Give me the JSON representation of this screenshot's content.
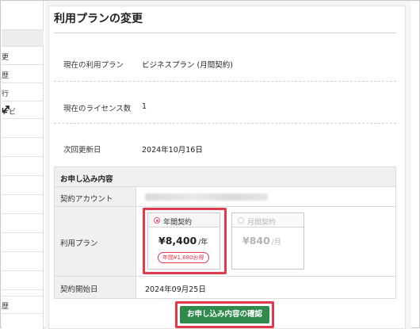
{
  "sidebar": {
    "items": [
      {
        "label": ""
      },
      {
        "label": ""
      },
      {
        "label": "更"
      },
      {
        "label": "歴"
      },
      {
        "label": "行"
      },
      {
        "label": "ナビ"
      },
      {
        "label": ""
      },
      {
        "label": ""
      },
      {
        "label": ""
      },
      {
        "label": ""
      },
      {
        "label": ""
      },
      {
        "label": ""
      },
      {
        "label": ""
      },
      {
        "label": ""
      },
      {
        "label": ""
      },
      {
        "label": ""
      },
      {
        "label": "歴"
      },
      {
        "label": ""
      }
    ]
  },
  "page": {
    "title": "利用プランの変更"
  },
  "current": {
    "plan_label": "現在の利用プラン",
    "plan_value": "ビジネスプラン (月間契約)",
    "license_label": "現在のライセンス数",
    "license_value": "1",
    "renewal_label": "次回更新日",
    "renewal_value": "2024年10月16日"
  },
  "order": {
    "header": "お申し込み内容",
    "account_label": "契約アカウント",
    "plan_label": "利用プラン",
    "start_label": "契約開始日",
    "start_value": "2024年09月25日",
    "annual": {
      "label": "年間契約",
      "price": "¥8,400",
      "unit": "/年",
      "badge": "年間¥1,680お得",
      "selected": true
    },
    "monthly": {
      "label": "月間契約",
      "price": "¥840",
      "unit": "/月",
      "selected": false
    }
  },
  "actions": {
    "confirm_label": "お申し込み内容の確認"
  },
  "colors": {
    "accent_red": "#e0394b",
    "button_green": "#2f8a4c",
    "radio_pink": "#e05a78"
  }
}
